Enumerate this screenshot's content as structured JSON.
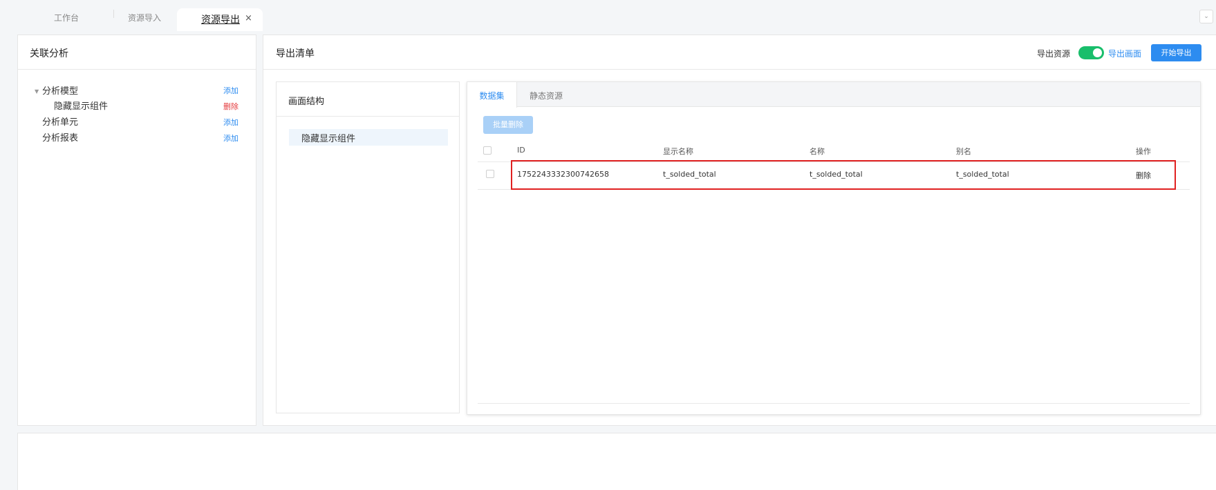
{
  "tabs": {
    "items": [
      "工作台",
      "资源导入"
    ],
    "active": "资源导出",
    "close": "×",
    "collapse": "⌄"
  },
  "left_panel": {
    "title": "关联分析",
    "tree": [
      {
        "label": "分析模型",
        "action": "添加"
      },
      {
        "label": "隐藏显示组件",
        "action": "删除"
      },
      {
        "label": "分析单元",
        "action": "添加"
      },
      {
        "label": "分析报表",
        "action": "添加"
      }
    ]
  },
  "right_panel": {
    "title": "导出清单",
    "switch_label": "导出资源",
    "switch_on": true,
    "export_screen_link": "导出画面",
    "start_button": "开始导出",
    "colors": {
      "accent": "#2d8cf0",
      "switch": "#19be6b",
      "danger": "#e4393c",
      "highlight": "#e02020"
    }
  },
  "structure": {
    "title": "画面结构",
    "items": [
      "隐藏显示组件"
    ]
  },
  "dataset": {
    "tabs": [
      "数据集",
      "静态资源"
    ],
    "active_tab": "数据集",
    "batch_delete": "批量删除",
    "columns": [
      "ID",
      "显示名称",
      "名称",
      "别名",
      "操作"
    ],
    "rows": [
      {
        "id": "1752243332300742658",
        "display_name": "t_solded_total",
        "name": "t_solded_total",
        "alias": "t_solded_total",
        "action": "删除"
      }
    ]
  }
}
